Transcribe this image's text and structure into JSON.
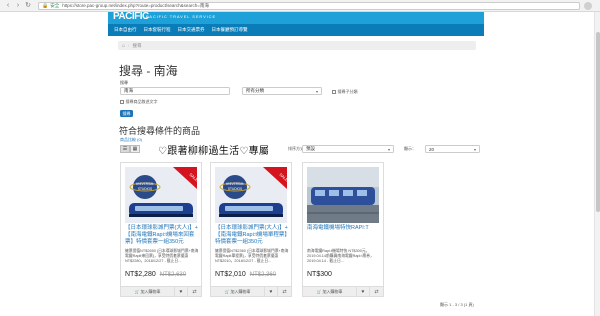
{
  "browser": {
    "secure_label": "安全",
    "url": "https://store.pac-group.net/index.php?route=product/search&search=南海"
  },
  "site": {
    "logo": "PACIFIC",
    "tagline": "PACIFIC TRAVEL SERVICE",
    "nav": [
      "日本自由行",
      "日本套裝行程",
      "日本交通票券",
      "日本餐廳預訂導覽"
    ]
  },
  "breadcrumb": {
    "item": "搜尋"
  },
  "search": {
    "heading": "搜尋 - 南海",
    "keyword_label": "搜尋",
    "keyword_value": "南海",
    "category_value": "所有分類",
    "subcategory_label": "搜尋子分類",
    "description_label": "搜尋商品敘述文字",
    "button": "搜尋"
  },
  "results": {
    "title": "符合搜尋條件的商品",
    "compare_link": "商品比較 (0)",
    "overlay_text": "♡跟著柳柳過生活♡專屬",
    "sort_label": "排序方式：",
    "sort_value": "預設",
    "limit_label": "顯示：",
    "limit_value": "20",
    "pagination": "顯示 1 - 3 / 3 (1 頁)"
  },
  "products": [
    {
      "title": "【日本環球影城門票(大人)】+【南海電鐵Rapi:t機場來回套票】特價套票一組350元",
      "desc": "擁票價值NT$2650 (日本環球影城門票+南海電鐵Rapit來回票)，享受特價套票優惠 NT$2280，2018/12/27 - 截止日...",
      "price": "NT$2,280",
      "old_price": "NT$2,630",
      "cart": "加入購物車",
      "sale": "SALE"
    },
    {
      "title": "【日本環球影城門票(大人)】+【南海電鐵Rapi:t機場單程票】特價套票一組350元",
      "desc": "擁票價值NT$2360 (日本環球影城門票+南海電鐵Rapit單程票)，享受特價套票優惠 NT$2010，2018/12/27 - 截止日...",
      "price": "NT$2,010",
      "old_price": "NT$2,360",
      "cart": "加入購物車",
      "sale": "SALE"
    },
    {
      "title": "南海電鐵機場特快RAPI:T",
      "desc": "南海電鐵Rapi:t機場特快 NT$300元，2019.04.14前購買南海電鐵Rapi:t票券，2019.04.14 - 截止日...",
      "price": "NT$300",
      "old_price": "",
      "cart": "加入購物車",
      "sale": ""
    }
  ],
  "colors": {
    "brand_blue": "#1ea0d8",
    "nav_blue": "#0a7cb7",
    "link_blue": "#1e74b8",
    "sale_red": "#d4141e"
  }
}
